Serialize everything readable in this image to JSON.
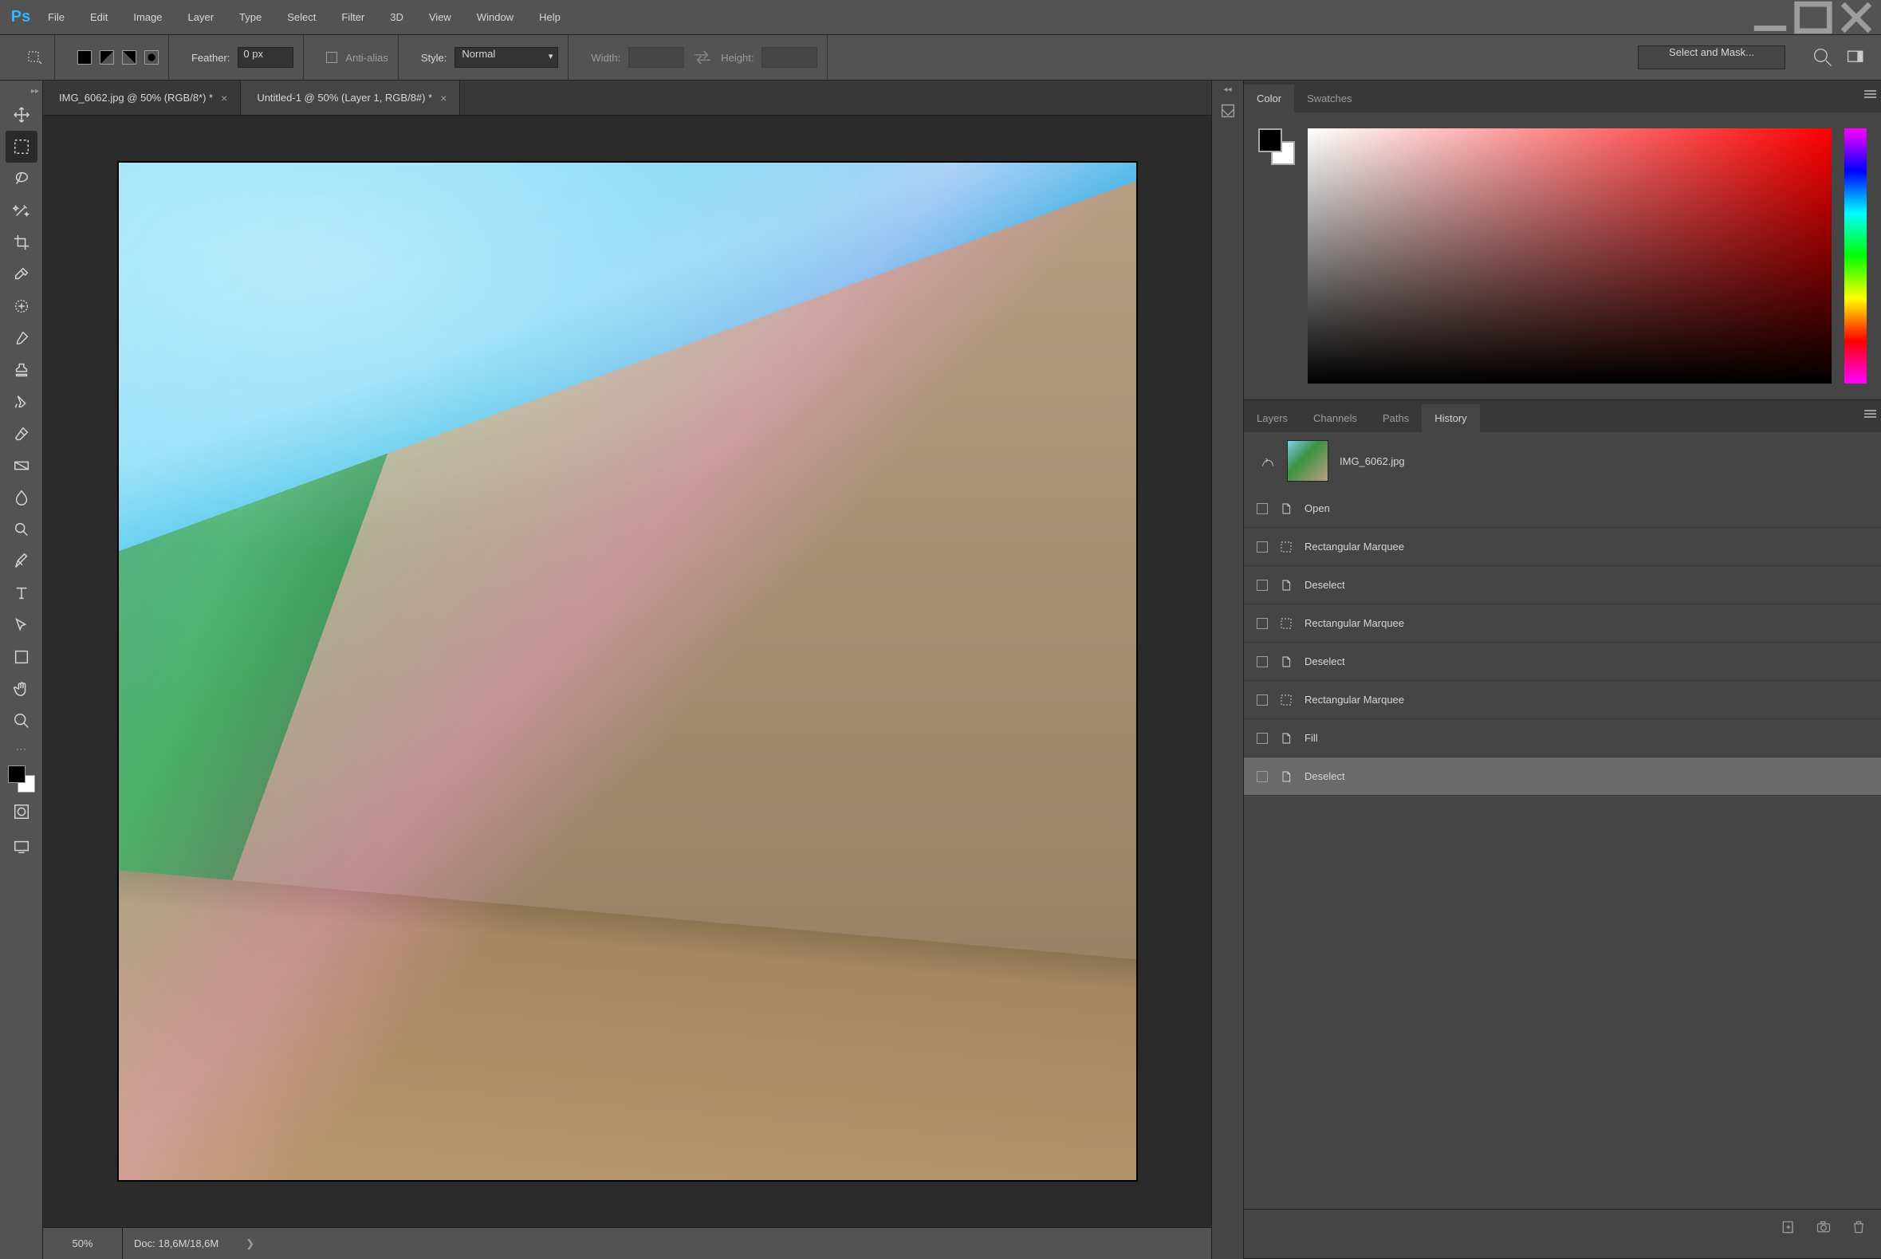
{
  "menu": {
    "items": [
      "File",
      "Edit",
      "Image",
      "Layer",
      "Type",
      "Select",
      "Filter",
      "3D",
      "View",
      "Window",
      "Help"
    ]
  },
  "options": {
    "feather_label": "Feather:",
    "feather_value": "0 px",
    "anti_alias_label": "Anti-alias",
    "style_label": "Style:",
    "style_value": "Normal",
    "width_label": "Width:",
    "width_value": "",
    "height_label": "Height:",
    "height_value": "",
    "select_mask": "Select and Mask..."
  },
  "tools": [
    {
      "name": "move-tool"
    },
    {
      "name": "marquee-tool",
      "active": true
    },
    {
      "name": "lasso-tool"
    },
    {
      "name": "magic-wand-tool"
    },
    {
      "name": "crop-tool"
    },
    {
      "name": "eyedropper-tool"
    },
    {
      "name": "spot-healing-tool"
    },
    {
      "name": "brush-tool"
    },
    {
      "name": "clone-stamp-tool"
    },
    {
      "name": "history-brush-tool"
    },
    {
      "name": "eraser-tool"
    },
    {
      "name": "gradient-tool"
    },
    {
      "name": "blur-tool"
    },
    {
      "name": "dodge-tool"
    },
    {
      "name": "pen-tool"
    },
    {
      "name": "type-tool"
    },
    {
      "name": "path-select-tool"
    },
    {
      "name": "shape-tool"
    },
    {
      "name": "hand-tool"
    },
    {
      "name": "zoom-tool"
    }
  ],
  "doc_tabs": [
    {
      "title": "IMG_6062.jpg @ 50% (RGB/8*) *",
      "active": true
    },
    {
      "title": "Untitled-1 @ 50% (Layer 1, RGB/8#) *",
      "active": false
    }
  ],
  "status": {
    "zoom": "50%",
    "doc": "Doc: 18,6M/18,6M"
  },
  "color_panel": {
    "tab1": "Color",
    "tab2": "Swatches",
    "fg": "#000000",
    "bg": "#ffffff"
  },
  "layers_panel": {
    "tabs": [
      "Layers",
      "Channels",
      "Paths",
      "History"
    ],
    "active_tab": "History"
  },
  "history": {
    "state": "IMG_6062.jpg",
    "items": [
      {
        "icon": "file-icon",
        "label": "Open"
      },
      {
        "icon": "marquee-icon",
        "label": "Rectangular Marquee"
      },
      {
        "icon": "file-icon",
        "label": "Deselect"
      },
      {
        "icon": "marquee-icon",
        "label": "Rectangular Marquee"
      },
      {
        "icon": "file-icon",
        "label": "Deselect"
      },
      {
        "icon": "marquee-icon",
        "label": "Rectangular Marquee"
      },
      {
        "icon": "file-icon",
        "label": "Fill"
      },
      {
        "icon": "file-icon",
        "label": "Deselect",
        "selected": true
      }
    ]
  }
}
